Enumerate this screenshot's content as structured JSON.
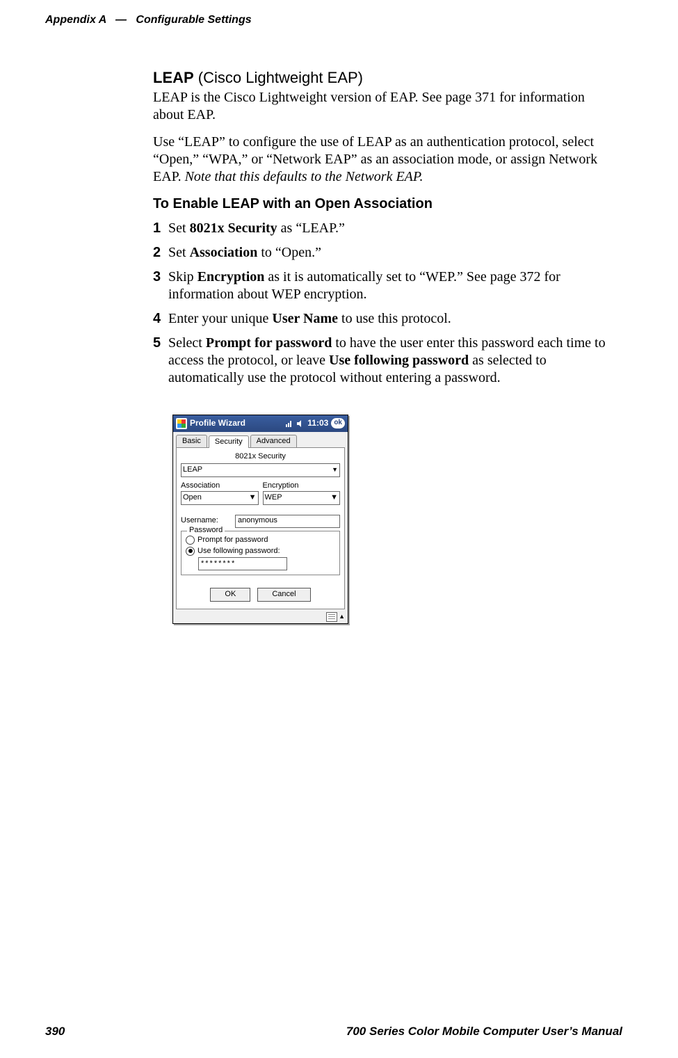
{
  "header": {
    "appendix": "Appendix  A",
    "separator": "—",
    "title": "Configurable Settings"
  },
  "section": {
    "heading_bold": "LEAP",
    "heading_rest": " (Cisco Lightweight EAP)",
    "p1": "LEAP is the Cisco Lightweight version of EAP. See page 371 for information about EAP.",
    "p2_a": "Use “LEAP” to configure the use of LEAP as an authentication protocol, select “Open,” “WPA,” or “Network EAP” as an association mode, or assign Network EAP. ",
    "p2_i": "Note that this defaults to the Network EAP.",
    "subheading": "To Enable LEAP with an Open Association",
    "steps": {
      "s1_a": "Set ",
      "s1_b": "8021x Security",
      "s1_c": " as “LEAP.”",
      "s2_a": "Set ",
      "s2_b": "Association",
      "s2_c": " to “Open.”",
      "s3_a": "Skip ",
      "s3_b": "Encryption",
      "s3_c": " as it is automatically set to “WEP.” See page 372 for information about WEP encryption.",
      "s4_a": "Enter your unique ",
      "s4_b": "User Name",
      "s4_c": " to use this protocol.",
      "s5_a": "Select ",
      "s5_b": "Prompt for password",
      "s5_c": " to have the user enter this password each time to access the protocol, or leave ",
      "s5_d": "Use following password",
      "s5_e": " as selected to automatically use the protocol without entering a password."
    },
    "nums": {
      "n1": "1",
      "n2": "2",
      "n3": "3",
      "n4": "4",
      "n5": "5"
    }
  },
  "screenshot": {
    "title": "Profile Wizard",
    "clock": "11:03",
    "ok": "ok",
    "tabs": {
      "basic": "Basic",
      "security": "Security",
      "advanced": "Advanced"
    },
    "group_label": "8021x Security",
    "security_value": "LEAP",
    "assoc_label": "Association",
    "assoc_value": "Open",
    "enc_label": "Encryption",
    "enc_value": "WEP",
    "username_label": "Username:",
    "username_value": "anonymous",
    "password_legend": "Password",
    "radio_prompt": "Prompt for password",
    "radio_use": "Use following password:",
    "password_value": "********",
    "ok_btn": "OK",
    "cancel_btn": "Cancel"
  },
  "footer": {
    "page": "390",
    "manual": "700 Series Color Mobile Computer User’s Manual"
  }
}
